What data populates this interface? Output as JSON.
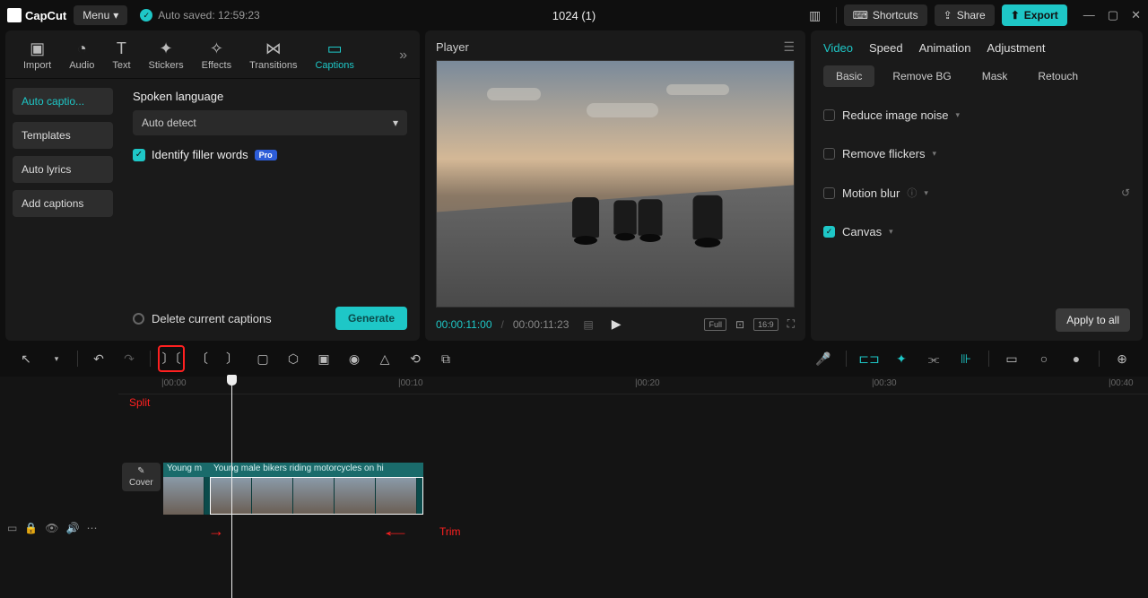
{
  "app": {
    "name": "CapCut",
    "menu": "Menu",
    "autosave": "Auto saved: 12:59:23",
    "title": "1024 (1)"
  },
  "topButtons": {
    "shortcuts": "Shortcuts",
    "share": "Share",
    "export": "Export"
  },
  "toolTabs": [
    "Import",
    "Audio",
    "Text",
    "Stickers",
    "Effects",
    "Transitions",
    "Captions"
  ],
  "sideItems": [
    "Auto captio...",
    "Templates",
    "Auto lyrics",
    "Add captions"
  ],
  "captions": {
    "langLabel": "Spoken language",
    "langValue": "Auto detect",
    "fillerLabel": "Identify filler words",
    "proBadge": "Pro",
    "deleteLabel": "Delete current captions",
    "generate": "Generate"
  },
  "player": {
    "title": "Player",
    "current": "00:00:11:00",
    "duration": "00:00:11:23",
    "full": "Full",
    "ratio": "16:9"
  },
  "rightTabs": [
    "Video",
    "Speed",
    "Animation",
    "Adjustment"
  ],
  "subTabs": [
    "Basic",
    "Remove BG",
    "Mask",
    "Retouch"
  ],
  "props": {
    "noise": "Reduce image noise",
    "flicker": "Remove flickers",
    "blur": "Motion blur",
    "canvas": "Canvas",
    "apply": "Apply to all"
  },
  "timeline": {
    "cover": "Cover",
    "caption1": "Young m",
    "caption2": "Young male bikers riding motorcycles on hi",
    "marks": [
      "|00:00",
      "|00:10",
      "|00:20",
      "|00:30",
      "|00:40"
    ],
    "splitLabel": "Split",
    "trimLabel": "Trim"
  }
}
